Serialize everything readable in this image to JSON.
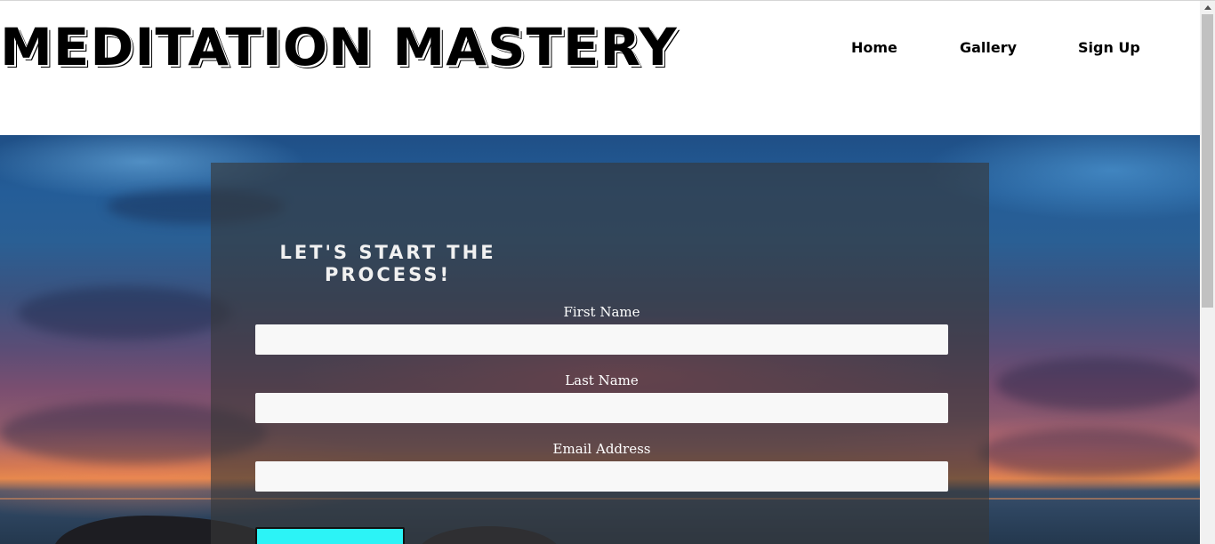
{
  "header": {
    "brand": "MEDITATION MASTERY",
    "nav": {
      "home": "Home",
      "gallery": "Gallery",
      "signup": "Sign Up"
    }
  },
  "form": {
    "title": "LET'S START THE PROCESS!",
    "fields": {
      "first_name": {
        "label": "First Name",
        "value": "",
        "placeholder": ""
      },
      "last_name": {
        "label": "Last Name",
        "value": "",
        "placeholder": ""
      },
      "email": {
        "label": "Email Address",
        "value": "",
        "placeholder": ""
      }
    },
    "submit_label": ""
  },
  "colors": {
    "submit_button": "#2cf3f6",
    "panel_overlay": "#373737",
    "input_bg": "#f8f8f8"
  }
}
